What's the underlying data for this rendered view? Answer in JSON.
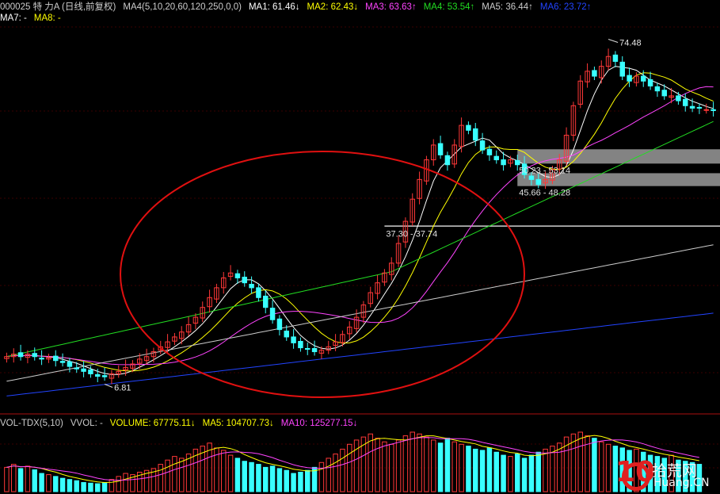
{
  "header": {
    "stock": "000025 特 力A (日线,前复权)",
    "ma_set": "MA4(5,10,20,60,120,250,0,0)",
    "ma_values": [
      {
        "label": "MA1: 61.46",
        "arrow": "↓",
        "color": "#ffffff"
      },
      {
        "label": "MA2: 62.43",
        "arrow": "↓",
        "color": "#ffff00"
      },
      {
        "label": "MA3: 63.63",
        "arrow": "↑",
        "color": "#ff44ff"
      },
      {
        "label": "MA4: 53.54",
        "arrow": "↑",
        "color": "#22dd22"
      },
      {
        "label": "MA5: 36.44",
        "arrow": "↑",
        "color": "#cccccc"
      },
      {
        "label": "MA6: 23.72",
        "arrow": "↑",
        "color": "#2244ff"
      }
    ],
    "ma_extra": [
      "MA7: -",
      "MA8: -"
    ]
  },
  "volume_header": {
    "name": "VOL-TDX(5,10)",
    "vvol": "VVOL: -",
    "items": [
      {
        "label": "VOLUME: 67775.11",
        "arrow": "↓",
        "color": "#ffff00"
      },
      {
        "label": "MA5: 104707.73",
        "arrow": "↓",
        "color": "#ffff00"
      },
      {
        "label": "MA10: 125277.15",
        "arrow": "↓",
        "color": "#ff44ff"
      }
    ]
  },
  "watermark": {
    "cn": "拾荒网",
    "en": "Huang.CN",
    "num": "10"
  },
  "chart_data": {
    "type": "candlestick",
    "ylim": [
      0,
      78
    ],
    "annotations": [
      {
        "text": "74.48",
        "kind": "high"
      },
      {
        "text": "6.81",
        "kind": "low"
      },
      {
        "text": "37.30 - 37.74",
        "kind": "gap"
      },
      {
        "text": "50.23 - 53.14",
        "kind": "gap"
      },
      {
        "text": "45.66 - 48.28",
        "kind": "gap"
      }
    ],
    "gaps": [
      [
        37.3,
        37.74
      ],
      [
        50.23,
        53.14
      ],
      [
        45.66,
        48.28
      ]
    ],
    "closes": [
      11,
      11.5,
      11,
      11.5,
      11,
      10.5,
      10.8,
      10.2,
      9.8,
      9,
      8.5,
      8,
      7.5,
      7,
      6.9,
      7.5,
      8,
      8.8,
      9.5,
      10.5,
      11,
      12,
      13,
      14,
      15,
      16,
      17.5,
      19,
      21,
      23,
      25,
      27,
      28,
      27,
      26,
      25,
      23,
      21,
      18.5,
      16.5,
      15,
      13.8,
      12.8,
      12.5,
      12,
      12.3,
      13,
      14,
      15.5,
      17,
      19,
      21.5,
      24,
      26,
      28,
      30,
      34,
      38.5,
      43,
      47,
      51,
      54,
      52,
      50,
      54,
      58,
      57,
      55,
      53,
      52,
      51,
      50,
      51,
      50,
      48,
      47,
      46,
      47,
      49,
      51,
      56,
      62,
      67,
      69,
      68,
      70,
      72,
      71,
      68,
      67,
      68,
      67,
      66,
      65,
      64,
      64,
      63,
      62,
      61.5,
      61.5,
      61.2,
      61
    ],
    "volumes": [
      40,
      45,
      38,
      42,
      36,
      30,
      28,
      25,
      22,
      20,
      18,
      15,
      14,
      13,
      15,
      20,
      25,
      30,
      28,
      32,
      35,
      38,
      45,
      52,
      58,
      55,
      62,
      70,
      75,
      80,
      72,
      68,
      60,
      55,
      50,
      48,
      45,
      40,
      42,
      38,
      35,
      30,
      32,
      35,
      40,
      48,
      55,
      62,
      70,
      78,
      85,
      90,
      95,
      88,
      82,
      78,
      85,
      92,
      98,
      95,
      90,
      85,
      80,
      88,
      82,
      78,
      75,
      70,
      68,
      72,
      65,
      60,
      58,
      62,
      55,
      60,
      65,
      70,
      75,
      80,
      90,
      95,
      98,
      92,
      88,
      82,
      78,
      75,
      72,
      68,
      70,
      65,
      60,
      58,
      55,
      60,
      52,
      50,
      48,
      45
    ],
    "series": [
      {
        "name": "MA1",
        "period": 5
      },
      {
        "name": "MA2",
        "period": 10
      },
      {
        "name": "MA3",
        "period": 20
      },
      {
        "name": "MA4",
        "period": 60
      },
      {
        "name": "MA5",
        "period": 120
      },
      {
        "name": "MA6",
        "period": 250
      }
    ]
  }
}
